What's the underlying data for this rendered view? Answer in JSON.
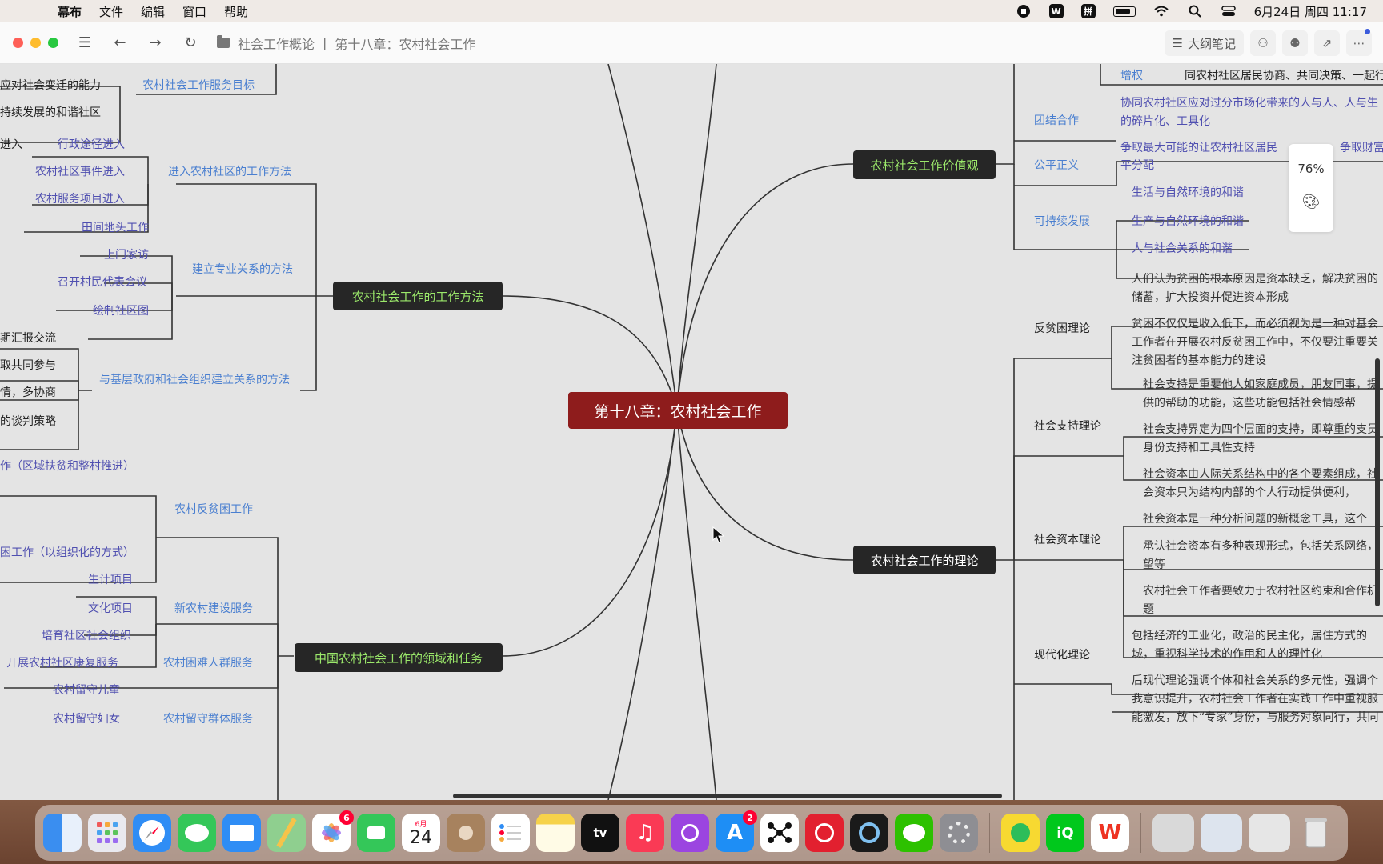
{
  "menubar": {
    "app_name": "幕布",
    "items": [
      "文件",
      "编辑",
      "窗口",
      "帮助"
    ],
    "datetime": "6月24日 周四  11:17"
  },
  "toolbar": {
    "breadcrumb_root": "社会工作概论",
    "separator": "|",
    "breadcrumb_current": "第十八章：农村社会工作",
    "outline_button": "大纲笔记"
  },
  "zoom": {
    "level": "76%"
  },
  "mindmap": {
    "root": "第十八章：农村社会工作",
    "branches": {
      "methods": "农村社会工作的工作方法",
      "values": "农村社会工作价值观",
      "theory": "农村社会工作的理论",
      "domains": "中国农村社会工作的领域和任务"
    },
    "left": {
      "goal_frag1": "应对社会变迁的能力",
      "goal_frag2": "持续发展的和谐社区",
      "goal_label": "农村社会工作服务目标",
      "enter_frag": "进入",
      "admin_entry": "行政途径进入",
      "event_entry": "农村社区事件进入",
      "project_entry": "农村服务项目进入",
      "enter_method": "进入农村社区的工作方法",
      "field_work": "田间地头工作",
      "home_visit": "上门家访",
      "villager_meeting": "召开村民代表会议",
      "draw_map": "绘制社区图",
      "relation_method": "建立专业关系的方法",
      "report_frag": "期汇报交流",
      "joint_frag": "取共同参与",
      "consult_frag": "情，多协商",
      "negotiate_frag": "的谈判策略",
      "gov_relation": "与基层政府和社会组织建立关系的方法",
      "poverty_frag1": "作（区域扶贫和整村推进）",
      "poverty_frag2": "困工作（以组织化的方式）",
      "anti_poverty": "农村反贫困工作",
      "livelihood": "生计项目",
      "culture": "文化项目",
      "cultivate_org": "培育社区社会组织",
      "new_village": "新农村建设服务",
      "rehab": "开展农村社区康复服务",
      "hardship": "农村困难人群服务",
      "left_children": "农村留守儿童",
      "left_women": "农村留守妇女",
      "left_behind": "农村留守群体服务"
    },
    "right": {
      "empower": "增权",
      "empower_desc": "同农村社区居民协商、共同决策、一起行",
      "unity": "团结合作",
      "unity_desc": "协同农村社区应对过分市场化带来的人与人、人与生的碎片化、工具化",
      "justice": "公平正义",
      "justice_desc": "争取最大可能的让农村社区居民",
      "justice_desc2": "争取财富",
      "justice_desc3": "平分配",
      "sustain": "可持续发展",
      "harmony1": "生活与自然环境的和谐",
      "harmony2": "生产与自然环境的和谐",
      "harmony3": "人与社会关系的和谐",
      "anti_poverty_theory": "反贫困理论",
      "ap_desc1": "人们认为贫困的根本原因是资本缺乏，解决贫困的储蓄，扩大投资并促进资本形成",
      "ap_desc2": "贫困不仅仅是收入低下，而必须视为是一种对基会工作者在开展农村反贫困工作中，不仅要注重要关注贫困者的基本能力的建设",
      "social_support": "社会支持理论",
      "ss_desc1": "社会支持是重要他人如家庭成员，朋友同事，提供的帮助的功能，这些功能包括社会情感帮",
      "ss_desc2": "社会支持界定为四个层面的支持，即尊重的支员身份支持和工具性支持",
      "social_capital": "社会资本理论",
      "sc_desc1": "社会资本由人际关系结构中的各个要素组成，社会资本只为结构内部的个人行动提供便利，",
      "sc_desc2": "社会资本是一种分析问题的新概念工具，这个",
      "sc_desc3": "承认社会资本有多种表现形式，包括关系网络，望等",
      "sc_desc4": "农村社会工作者要致力于农村社区约束和合作机题",
      "modernization": "现代化理论",
      "mod_desc": "包括经济的工业化，政治的民主化，居住方式的城，重视科学技术的作用和人的理性化",
      "postmod_desc": "后现代理论强调个体和社会关系的多元性，强调个我意识提升，农村社会工作者在实践工作中重视服能激发，放下“专家”身份，与服务对象同行，共同"
    }
  },
  "dock": {
    "photos_badge": "6",
    "calendar_month": "6月",
    "calendar_day": "24",
    "appstore_badge": "2",
    "tv_label": "tv"
  }
}
